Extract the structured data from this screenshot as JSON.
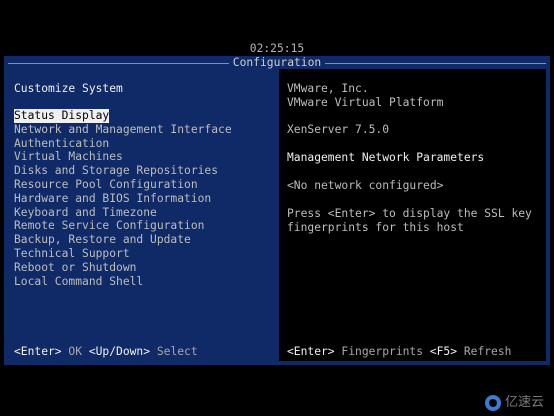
{
  "clock": "02:25:15",
  "window": {
    "title": "Configuration"
  },
  "left": {
    "heading": "Customize System",
    "menu": [
      "Status Display",
      "Network and Management Interface",
      "Authentication",
      "Virtual Machines",
      "Disks and Storage Repositories",
      "Resource Pool Configuration",
      "Hardware and BIOS Information",
      "Keyboard and Timezone",
      "Remote Service Configuration",
      "Backup, Restore and Update",
      "Technical Support",
      "Reboot or Shutdown",
      "Local Command Shell"
    ],
    "selected_index": 0,
    "footer": {
      "key1": "<Enter>",
      "text1": " OK ",
      "key2": "<Up/Down>",
      "text2": " Select"
    }
  },
  "right": {
    "vendor": "VMware, Inc.",
    "platform": "VMware Virtual Platform",
    "product": "XenServer 7.5.0",
    "section_title": "Management Network Parameters",
    "network_status": "<No network configured>",
    "hint_line1": "Press <Enter> to display the SSL key",
    "hint_line2": "fingerprints for this host",
    "footer": {
      "key1": "<Enter>",
      "text1": " Fingerprints ",
      "key2": "<F5>",
      "text2": " Refresh"
    }
  },
  "watermark": {
    "text": "亿速云",
    "icon": "cloud-logo-icon"
  }
}
